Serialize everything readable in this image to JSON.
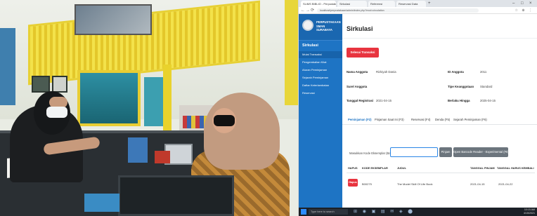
{
  "browser": {
    "tabs": [
      "SLiMS BIBLIO - Perpustakaan",
      "Sirkulasi",
      "Referensi",
      "Reservasi Data"
    ],
    "new_tab": "+",
    "url": "localhost/perpustakaan/admin/index.php?mod=circulation",
    "controls": {
      "minimize": "–",
      "maximize": "□",
      "close": "×"
    },
    "nav": {
      "back": "←",
      "forward": "→",
      "reload": "⟳"
    },
    "extensions": "☆ ⊕ ⋮"
  },
  "sidebar": {
    "brand": "PERPUSTAKAAN SMAN SURABAYA",
    "section": "Sirkulasi",
    "items": [
      {
        "label": "Mulai Transaksi",
        "active": true
      },
      {
        "label": "Pengembalian Kilat",
        "active": false
      },
      {
        "label": "Aturan Peminjaman",
        "active": false
      },
      {
        "label": "Sejarah Peminjaman",
        "active": false
      },
      {
        "label": "Daftar Keterlambatan",
        "active": false
      },
      {
        "label": "Reservasi",
        "active": false
      }
    ]
  },
  "main": {
    "title": "Sirkulasi",
    "select_button": "Selesai Transaksi (Esc)",
    "member": {
      "name_label": "Nama Anggota",
      "name_value": "Rizkiyah Dania",
      "id_label": "ID Anggota",
      "id_value": "2011",
      "email_label": "Surel Anggota",
      "email_value": "",
      "type_label": "Tipe Keanggotaan",
      "type_value": "Standard",
      "reg_label": "Tanggal Registrasi",
      "reg_value": "2021-04-15",
      "expire_label": "Berlaku Hingga",
      "expire_value": "2025-04-15"
    },
    "tabs": [
      "Peminjaman (F2)",
      "Pinjaman Saat Ini (F3)",
      "Reservasi (F4)",
      "Denda (F5)",
      "Sejarah Peminjaman (F6)"
    ],
    "scan": {
      "label": "Masukkan Kode Eksemplar (Barcode)",
      "value": "",
      "lend_button": "Pinjam",
      "reader_button": "Open Barcode Reader - Experimental (F8)"
    },
    "table": {
      "headers": [
        "HAPUS",
        "KODE EKSEMPLAR",
        "JUDUL",
        "TANGGAL PINJAM",
        "TANGGAL HARUS KEMBALI"
      ],
      "rows": [
        {
          "delete": "Hapus",
          "code": "B00275",
          "title": "The Model Skill Of Life Book",
          "loan_date": "2021-04-15",
          "due_date": "2021-04-22"
        }
      ]
    }
  },
  "taskbar": {
    "search": "Type here to search",
    "icons": "⊞ ◉ ▣ ▤ ✉ ◈ ⬤",
    "clock": "10:15 AM",
    "date": "4/15/2021"
  },
  "colors": {
    "sidebar": "#1e74c4",
    "danger": "#e8343f",
    "secondary": "#6c757d",
    "taskbar": "#1b2027"
  }
}
